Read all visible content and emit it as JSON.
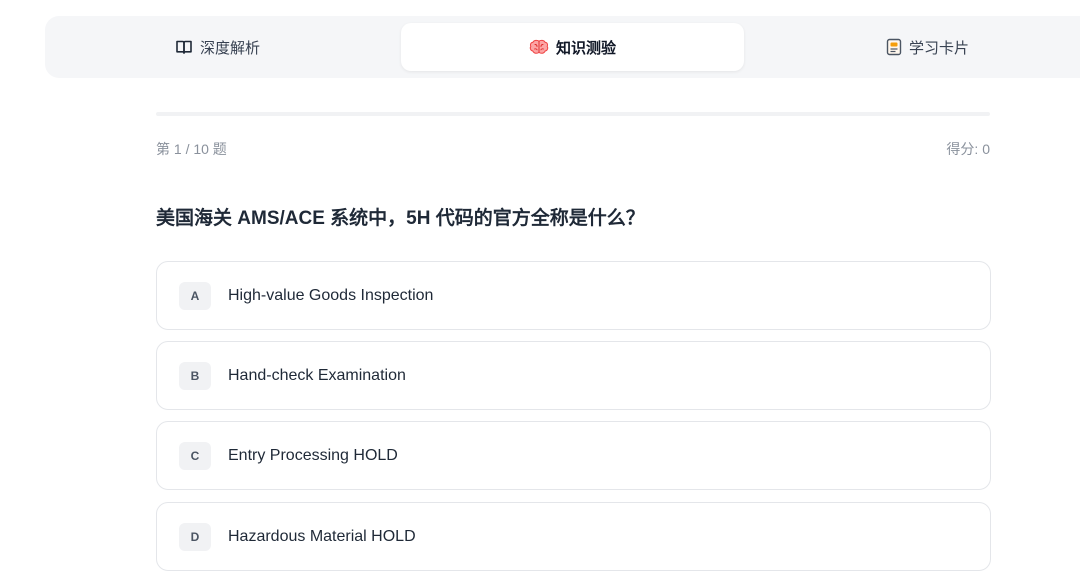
{
  "tabs": [
    {
      "label": "深度解析",
      "icon": "book-open-icon"
    },
    {
      "label": "知识测验",
      "icon": "brain-icon",
      "active": true
    },
    {
      "label": "学习卡片",
      "icon": "flashcard-icon"
    }
  ],
  "quiz": {
    "counter": "第 1 / 10 题",
    "score": "得分: 0",
    "progress": 0,
    "question": "美国海关 AMS/ACE 系统中，5H 代码的官方全称是什么？",
    "options": [
      {
        "letter": "A",
        "text": "High-value Goods Inspection"
      },
      {
        "letter": "B",
        "text": "Hand-check Examination"
      },
      {
        "letter": "C",
        "text": "Entry Processing HOLD"
      },
      {
        "letter": "D",
        "text": "Hazardous Material HOLD"
      }
    ]
  },
  "colors": {
    "accent": "#4f46e5",
    "brain_icon": "#f87171"
  }
}
